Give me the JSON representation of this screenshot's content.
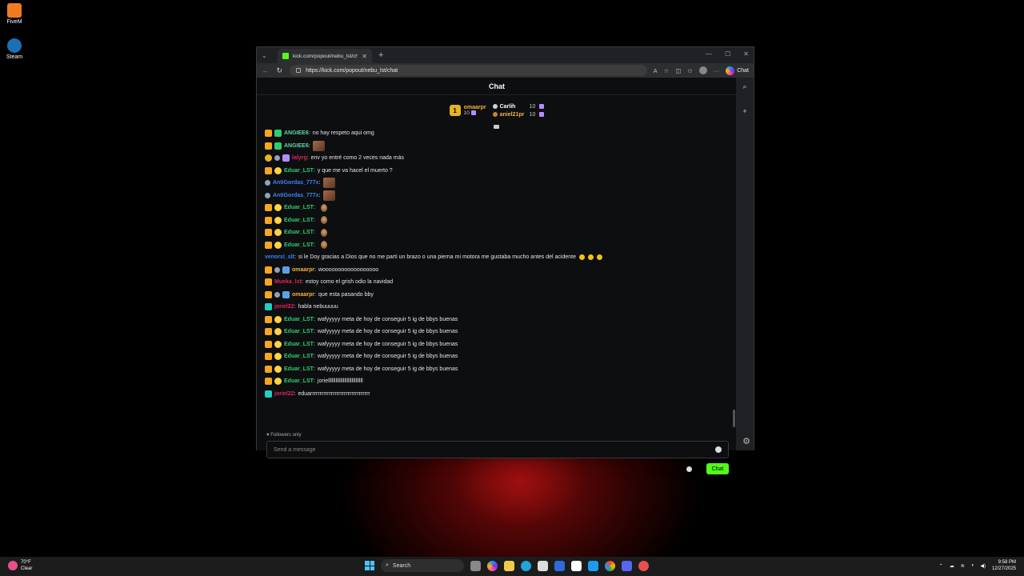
{
  "desktop": {
    "icons": [
      {
        "label": "FiveM",
        "color": "#f27c1d"
      },
      {
        "label": "Steam",
        "color": "#1b6fb5"
      }
    ]
  },
  "browser": {
    "tab_title": "kick.com/popout/nebu_lst/chat",
    "url": "https://kick.com/popout/nebu_lst/chat",
    "copilot_label": "Chat"
  },
  "chat": {
    "header": "Chat",
    "leaderboard": {
      "first": {
        "rank": "1",
        "name": "omaarpr",
        "count": "10"
      },
      "second": {
        "name": "Carlih",
        "count": "10"
      },
      "third": {
        "name": "aniel21pr",
        "count": "10"
      }
    },
    "messages": [
      {
        "badges": [
          "crown",
          "green"
        ],
        "user": "ANGIEE6",
        "color": "#5bd6a7",
        "sep": ":",
        "text": "no hay respeto aqui omg",
        "emote": ""
      },
      {
        "badges": [
          "crown",
          "green"
        ],
        "user": "ANGIEE6",
        "color": "#5bd6a7",
        "sep": ":",
        "text": "",
        "emote": "big"
      },
      {
        "badges": [
          "num",
          "ghost",
          "gem"
        ],
        "user": "lalyrg",
        "color": "#e0245e",
        "sep": ":",
        "text": "env yo entré como 2 veces nada más",
        "emote": ""
      },
      {
        "badges": [
          "crown",
          "vip"
        ],
        "user": "Eduar_LST",
        "color": "#2ecc71",
        "sep": ":",
        "text": "y que me va hacel el muerto ?",
        "emote": ""
      },
      {
        "badges": [
          "ghost"
        ],
        "user": "AntiGordas_777x",
        "color": "#3b82f6",
        "sep": ":",
        "text": "",
        "emote": "big"
      },
      {
        "badges": [
          "ghost"
        ],
        "user": "AntiGordas_777x",
        "color": "#3b82f6",
        "sep": ":",
        "text": "",
        "emote": "big"
      },
      {
        "badges": [
          "crown",
          "vip"
        ],
        "user": "Eduar_LST",
        "color": "#2ecc71",
        "sep": ":",
        "text": "",
        "emote": "small"
      },
      {
        "badges": [
          "crown",
          "vip"
        ],
        "user": "Eduar_LST",
        "color": "#2ecc71",
        "sep": ":",
        "text": "",
        "emote": "small"
      },
      {
        "badges": [
          "crown",
          "vip"
        ],
        "user": "Eduar_LST",
        "color": "#2ecc71",
        "sep": ":",
        "text": "",
        "emote": "small"
      },
      {
        "badges": [
          "crown",
          "vip"
        ],
        "user": "Eduar_LST",
        "color": "#2ecc71",
        "sep": ":",
        "text": "",
        "emote": "small"
      },
      {
        "badges": [],
        "user": "venorsl_slt",
        "color": "#3b82f6",
        "sep": ":",
        "text": "si le Doy gracias a Dios que no me parti un brazo o una pierna mi motora me gustaba mucho antes del acidente",
        "emote": "emojis"
      },
      {
        "badges": [
          "crown",
          "ghost",
          "sub"
        ],
        "user": "omaarpr",
        "color": "#f5b041",
        "sep": ":",
        "text": "woooooooooooooooooo",
        "emote": ""
      },
      {
        "badges": [
          "crown"
        ],
        "user": "Mueka_lst",
        "color": "#e0245e",
        "sep": ":",
        "text": "estoy como el grish odio la navidad",
        "emote": ""
      },
      {
        "badges": [
          "crown",
          "ghost",
          "sub"
        ],
        "user": "omaarpr",
        "color": "#f5b041",
        "sep": ":",
        "text": "que esta pasando bby",
        "emote": ""
      },
      {
        "badges": [
          "teal"
        ],
        "user": "joriel22",
        "color": "#e0245e",
        "sep": ":",
        "text": "habla nebuuuuu",
        "emote": ""
      },
      {
        "badges": [
          "crown",
          "vip"
        ],
        "user": "Eduar_LST",
        "color": "#2ecc71",
        "sep": ":",
        "text": "wafyyyyy meta de hoy de conseguir 5 ig de bbys buenas",
        "emote": ""
      },
      {
        "badges": [
          "crown",
          "vip"
        ],
        "user": "Eduar_LST",
        "color": "#2ecc71",
        "sep": ":",
        "text": "wafyyyyy meta de hoy de conseguir 5 ig de bbys buenas",
        "emote": ""
      },
      {
        "badges": [
          "crown",
          "vip"
        ],
        "user": "Eduar_LST",
        "color": "#2ecc71",
        "sep": ":",
        "text": "wafyyyyy meta de hoy de conseguir 5 ig de bbys buenas",
        "emote": ""
      },
      {
        "badges": [
          "crown",
          "vip"
        ],
        "user": "Eduar_LST",
        "color": "#2ecc71",
        "sep": ":",
        "text": "wafyyyyy meta de hoy de conseguir 5 ig de bbys buenas",
        "emote": ""
      },
      {
        "badges": [
          "crown",
          "vip"
        ],
        "user": "Eduar_LST",
        "color": "#2ecc71",
        "sep": ":",
        "text": "wafyyyyy meta de hoy de conseguir 5 ig de bbys buenas",
        "emote": ""
      },
      {
        "badges": [
          "crown",
          "vip"
        ],
        "user": "Eduar_LST",
        "color": "#2ecc71",
        "sep": ":",
        "text": "joriellllllllllllllllllllllllllll",
        "emote": ""
      },
      {
        "badges": [
          "teal"
        ],
        "user": "joriel22",
        "color": "#e0245e",
        "sep": ":",
        "text": "eduarrrrrrrrrrrrrrrrrrrrrrrrrrrrrrrr",
        "emote": ""
      }
    ],
    "followers_only": "Followers only",
    "input_placeholder": "Send a message",
    "send_label": "Chat"
  },
  "taskbar": {
    "weather_temp": "70°F",
    "weather_desc": "Clear",
    "search_label": "Search",
    "time": "9:58 PM",
    "date": "12/27/2025"
  }
}
